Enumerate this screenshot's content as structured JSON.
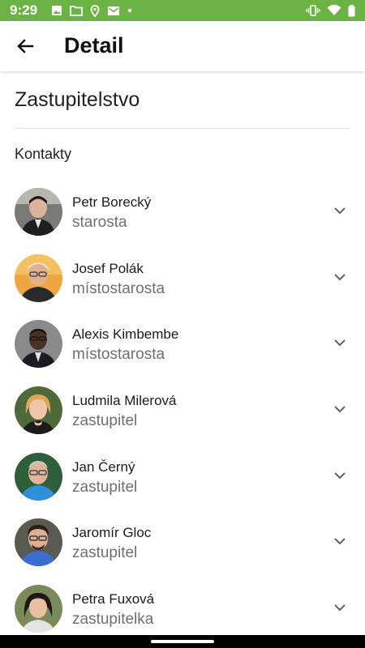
{
  "status_bar": {
    "time": "9:29",
    "left_icons": [
      "photo-icon",
      "folder-icon",
      "location-icon",
      "mail-icon",
      "dot-icon"
    ],
    "right_icons": [
      "vibrate-icon",
      "wifi-icon",
      "battery-icon"
    ],
    "color": "#6ab344"
  },
  "app_bar": {
    "back_icon": "arrow-back-icon",
    "title": "Detail"
  },
  "section": {
    "title": "Zastupitelstvo",
    "contacts_label": "Kontakty"
  },
  "contacts": [
    {
      "name": "Petr Borecký",
      "role": "starosta"
    },
    {
      "name": "Josef Polák",
      "role": "místostarosta"
    },
    {
      "name": "Alexis Kimbembe",
      "role": "místostarosta"
    },
    {
      "name": "Ludmila Milerová",
      "role": "zastupitel"
    },
    {
      "name": "Jan Černý",
      "role": "zastupitel"
    },
    {
      "name": "Jaromír Gloc",
      "role": "zastupitel"
    },
    {
      "name": "Petra Fuxová",
      "role": "zastupitelka"
    }
  ],
  "colors": {
    "role_text": "#6f6f6f",
    "divider": "#e2e2e2"
  }
}
